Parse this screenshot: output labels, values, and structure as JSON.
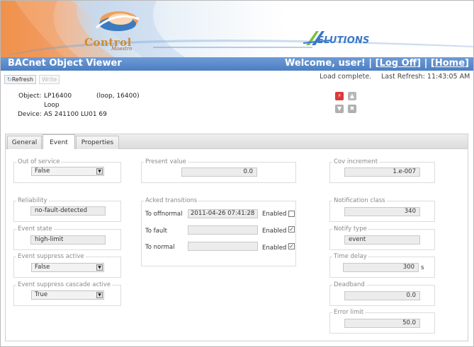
{
  "header": {
    "control_logo_word": "Control",
    "control_logo_sub": "Maestro",
    "solutions_logo": "ELUTIONS"
  },
  "titlebar": {
    "title": "BACnet Object Viewer",
    "welcome": "Welcome, user!",
    "sep1": " | [",
    "logoff": "Log Off",
    "sep2": "] | [",
    "home": "Home",
    "sep3": "]"
  },
  "toolbar": {
    "refresh_label": "Refresh",
    "write_label": "Write",
    "status": "Load complete.",
    "last_refresh": "Last Refresh: 11:43:05 AM"
  },
  "object": {
    "object_label": "Object:",
    "object_name": "LP16400",
    "object_id": "(loop, 16400)",
    "object_type": "Loop",
    "device_label": "Device:",
    "device_name": "AS 241100 LU01 69"
  },
  "status_icons": [
    "alarm-icon",
    "fault-icon",
    "overridden-icon",
    "out-of-service-icon"
  ],
  "colors": {
    "title_bar": "#5588c9",
    "alarm": "#d83a3a",
    "banner_orange": "#f29b54"
  },
  "tabs": [
    "General",
    "Event",
    "Properties"
  ],
  "active_tab": "Event",
  "event": {
    "out_of_service": {
      "label": "Out of service",
      "value": "False"
    },
    "reliability": {
      "label": "Reliability",
      "value": "no-fault-detected"
    },
    "event_state": {
      "label": "Event state",
      "value": "high-limit"
    },
    "event_suppress_active": {
      "label": "Event suppress active",
      "value": "False"
    },
    "event_suppress_cascade_active": {
      "label": "Event suppress cascade active",
      "value": "True"
    },
    "present_value": {
      "label": "Present value",
      "value": "0.0"
    },
    "acked_transitions": {
      "label": "Acked transitions",
      "rows": [
        {
          "label": "To offnormal",
          "value": "2011-04-26 07:41:28",
          "enabled_label": "Enabled",
          "checked": false
        },
        {
          "label": "To fault",
          "value": "",
          "enabled_label": "Enabled",
          "checked": true
        },
        {
          "label": "To normal",
          "value": "",
          "enabled_label": "Enabled",
          "checked": true
        }
      ]
    },
    "cov_increment": {
      "label": "Cov increment",
      "value": "1.e-007"
    },
    "notification_class": {
      "label": "Notification class",
      "value": "340"
    },
    "notify_type": {
      "label": "Notify type",
      "value": "event"
    },
    "time_delay": {
      "label": "Time delay",
      "value": "300",
      "unit": "s"
    },
    "deadband": {
      "label": "Deadband",
      "value": "0.0"
    },
    "error_limit": {
      "label": "Error limit",
      "value": "50.0"
    }
  }
}
